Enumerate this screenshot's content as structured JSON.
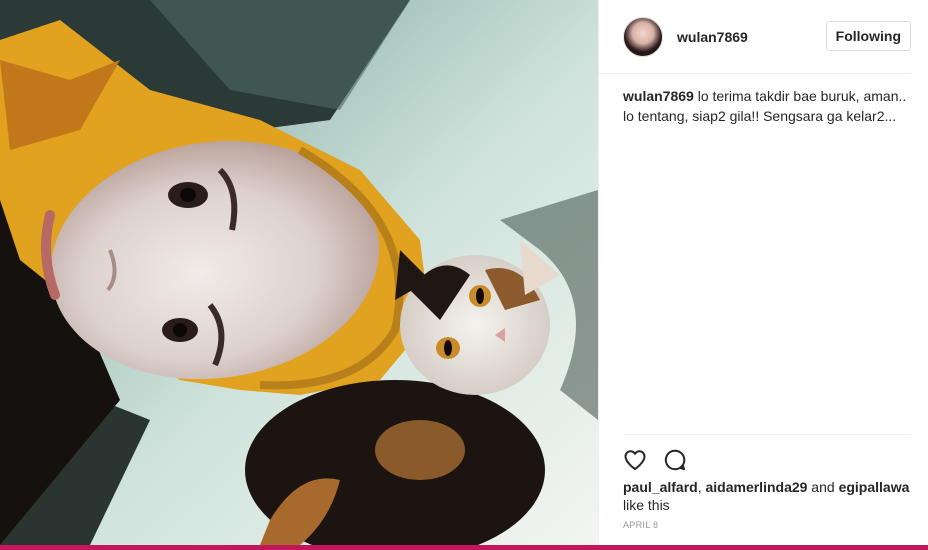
{
  "post": {
    "username": "wulan7869",
    "follow_label": "Following",
    "caption_user": "wulan7869",
    "caption_text": " lo terima takdir bae buruk, aman.. lo tentang, siap2 gila!! Sengsara ga kelar2...",
    "likers": [
      "paul_alfard",
      "aidamerlinda29",
      "egipallawa"
    ],
    "likes_connector": " and ",
    "likes_suffix": "like this",
    "date": "APRIL 8"
  },
  "icons": {
    "like": "heart-icon",
    "comment": "comment-icon"
  },
  "colors": {
    "accent_bar": "#c2185b",
    "hijab": "#e0a21f",
    "border": "#efefef"
  }
}
